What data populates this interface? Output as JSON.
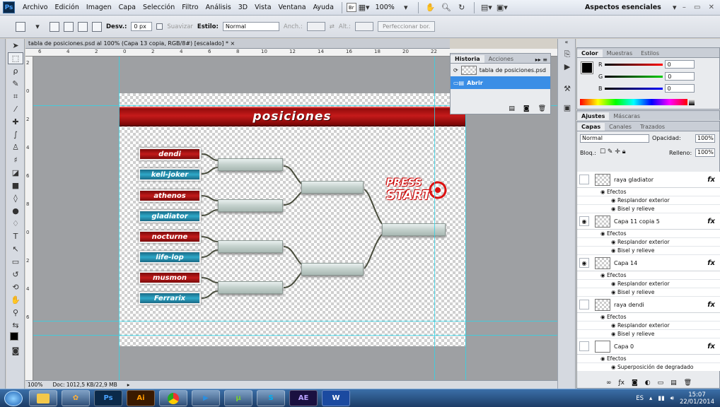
{
  "menubar": {
    "logo": "Ps",
    "items": [
      "Archivo",
      "Edición",
      "Imagen",
      "Capa",
      "Selección",
      "Filtro",
      "Análisis",
      "3D",
      "Vista",
      "Ventana",
      "Ayuda"
    ],
    "badge_br": "Br",
    "zoom": "100%",
    "workspace": "Aspectos esenciales",
    "window_controls": "– ▭ ✕"
  },
  "options": {
    "desv_label": "Desv.:",
    "desv_value": "0 px",
    "suavizar": "Suavizar",
    "estilo_label": "Estilo:",
    "estilo_value": "Normal",
    "anch_label": "Anch.:",
    "alt_label": "Alt.:",
    "refine_button": "Perfeccionar bor."
  },
  "document": {
    "tab_title": "tabla de posiciones.psd al 100% (Capa 13 copia, RGB/8#) [escalado] * ×",
    "ruler_h": [
      "6",
      "4",
      "2",
      "0",
      "2",
      "4",
      "6",
      "8",
      "10",
      "12",
      "14",
      "16",
      "18",
      "20",
      "22"
    ],
    "ruler_v": [
      "2",
      "0",
      "2",
      "4",
      "6",
      "8",
      "0",
      "2",
      "4",
      "6"
    ],
    "banner_title": "posiciones",
    "players": [
      {
        "name": "dendi",
        "color": "red"
      },
      {
        "name": "kell-joker",
        "color": "teal"
      },
      {
        "name": "athenos",
        "color": "red"
      },
      {
        "name": "gladiator",
        "color": "teal"
      },
      {
        "name": "nocturne",
        "color": "red"
      },
      {
        "name": "life-lop",
        "color": "teal"
      },
      {
        "name": "musmon",
        "color": "red"
      },
      {
        "name": "Ferrarix",
        "color": "teal"
      }
    ],
    "logo_line1": "PRESS",
    "logo_line2": "START"
  },
  "history": {
    "tabs": [
      "Historia",
      "Acciones"
    ],
    "rows": [
      {
        "label": "tabla de posiciones.psd",
        "selected": false
      },
      {
        "label": "Abrir",
        "selected": true
      }
    ]
  },
  "color_panel": {
    "tabs": [
      "Color",
      "Muestras",
      "Estilos"
    ],
    "channels": [
      {
        "label": "R",
        "value": "0"
      },
      {
        "label": "G",
        "value": "0"
      },
      {
        "label": "B",
        "value": "0"
      }
    ]
  },
  "adjust_tabs": [
    "Ajustes",
    "Máscaras"
  ],
  "layers": {
    "tabs": [
      "Capas",
      "Canales",
      "Trazados"
    ],
    "blend_mode": "Normal",
    "opacity_label": "Opacidad:",
    "opacity_value": "100%",
    "lock_label": "Bloq.:",
    "fill_label": "Relleno:",
    "fill_value": "100%",
    "items": [
      {
        "name": "raya gladiator",
        "visible": false,
        "thumb": "checker",
        "effects": [
          "Resplandor exterior",
          "Bisel y relieve"
        ]
      },
      {
        "name": "Capa 11 copia 5",
        "visible": true,
        "thumb": "checker",
        "effects": [
          "Resplandor exterior",
          "Bisel y relieve"
        ]
      },
      {
        "name": "Capa 14",
        "visible": true,
        "thumb": "checker",
        "effects": [
          "Resplandor exterior",
          "Bisel y relieve"
        ]
      },
      {
        "name": "raya dendi",
        "visible": false,
        "thumb": "checker",
        "effects": [
          "Resplandor exterior",
          "Bisel y relieve"
        ]
      },
      {
        "name": "Capa 0",
        "visible": false,
        "thumb": "white",
        "effects": [
          "Superposición de degradado"
        ]
      }
    ],
    "effects_label": "Efectos",
    "fx": "fx"
  },
  "status": {
    "zoom": "100%",
    "doc": "Doc: 1012,5 KB/22,9 MB"
  },
  "taskbar": {
    "apps": [
      "",
      "",
      "Ps",
      "Ai",
      "",
      "",
      "",
      "S",
      "AE",
      "W"
    ],
    "lang": "ES",
    "time": "15:07",
    "date": "22/01/2014"
  }
}
